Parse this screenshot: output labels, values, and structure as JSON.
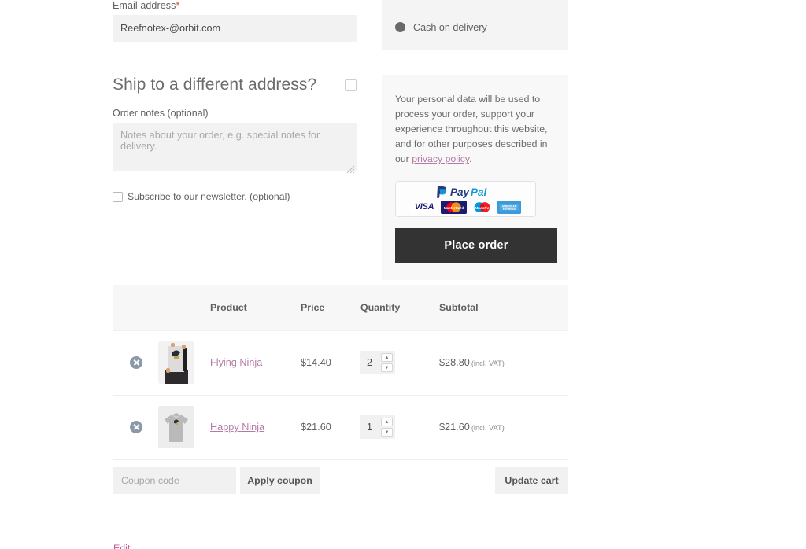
{
  "billing": {
    "email_label": "Email address",
    "required_marker": "*",
    "email_value": "Reefnotex-@orbit.com",
    "ship_different_heading": "Ship to a different address?",
    "order_notes_label": "Order notes (optional)",
    "order_notes_placeholder": "Notes about your order, e.g. special notes for delivery.",
    "order_notes_value": "",
    "newsletter_label": "Subscribe to our newsletter. (optional)"
  },
  "payment": {
    "method_label": "Cash on delivery",
    "privacy_text_before": "Your personal data will be used to process your order, support your experience throughout this website, and for other purposes described in our ",
    "privacy_link_text": "privacy policy",
    "privacy_text_after": ".",
    "paypal_brand": "PayPal",
    "cards": [
      {
        "name": "visa-card-logo",
        "label": "VISA"
      },
      {
        "name": "mastercard-card-logo",
        "label": "MasterCard"
      },
      {
        "name": "maestro-card-logo",
        "label": "Maestro"
      },
      {
        "name": "amex-card-logo",
        "label": "AMERICAN EXPRESS"
      }
    ],
    "place_order_label": "Place order"
  },
  "cart": {
    "columns": [
      "",
      "",
      "Product",
      "Price",
      "Quantity",
      "Subtotal"
    ],
    "rows": [
      {
        "remove_icon": "remove-circle-icon",
        "thumbnail": "flying-ninja-thumbnail",
        "product": "Flying Ninja",
        "price": "$14.40",
        "quantity": "2",
        "subtotal": "$28.80",
        "subtotal_note": "(incl. VAT)"
      },
      {
        "remove_icon": "remove-circle-icon",
        "thumbnail": "happy-ninja-thumbnail",
        "product": "Happy Ninja",
        "price": "$21.60",
        "quantity": "1",
        "subtotal": "$21.60",
        "subtotal_note": "(incl. VAT)"
      }
    ],
    "coupon_placeholder": "Coupon code",
    "coupon_value": "",
    "apply_coupon_label": "Apply coupon",
    "update_cart_label": "Update cart"
  },
  "footer": {
    "edit_label": "Edit"
  },
  "colors": {
    "accent_link": "#b47ba5",
    "place_order_bg": "#333333",
    "panel_bg": "#f4f4f4",
    "input_bg": "#f1f1f1",
    "required_star": "#e2401c"
  }
}
